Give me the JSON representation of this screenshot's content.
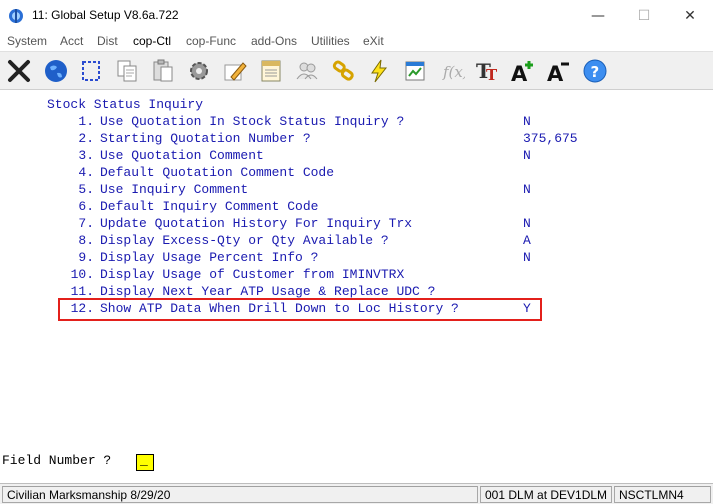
{
  "window": {
    "title": "11: Global Setup V8.6a.722",
    "minimize_glyph": "—",
    "maximize_glyph": "☐",
    "close_glyph": "✕"
  },
  "menu": [
    {
      "label": "System",
      "active": false
    },
    {
      "label": "Acct",
      "active": false
    },
    {
      "label": "Dist",
      "active": false
    },
    {
      "label": "cop-Ctl",
      "active": true
    },
    {
      "label": "cop-Func",
      "active": false
    },
    {
      "label": "add-Ons",
      "active": false
    },
    {
      "label": "Utilities",
      "active": false
    },
    {
      "label": "eXit",
      "active": false
    }
  ],
  "toolbar_icons": [
    "close-icon",
    "globe-icon",
    "select-icon",
    "copy-icon",
    "paste-icon",
    "settings-icon",
    "edit-icon",
    "document-icon",
    "users-icon",
    "link-icon",
    "lightning-icon",
    "chart-icon",
    "function-icon",
    "font-icon",
    "font-increase-icon",
    "font-decrease-icon",
    "help-icon"
  ],
  "screen": {
    "header": "Stock Status Inquiry",
    "options": [
      {
        "num": "1.",
        "label": "Use Quotation In Stock Status Inquiry ?",
        "value": "N"
      },
      {
        "num": "2.",
        "label": "Starting Quotation Number ?",
        "value": "375,675"
      },
      {
        "num": "3.",
        "label": "Use Quotation Comment",
        "value": "N"
      },
      {
        "num": "4.",
        "label": "Default Quotation Comment Code",
        "value": ""
      },
      {
        "num": "5.",
        "label": "Use Inquiry Comment",
        "value": "N"
      },
      {
        "num": "6.",
        "label": "Default Inquiry Comment Code",
        "value": ""
      },
      {
        "num": "7.",
        "label": "Update Quotation History For Inquiry Trx",
        "value": "N"
      },
      {
        "num": "8.",
        "label": "Display Excess-Qty or Qty Available ?",
        "value": "A"
      },
      {
        "num": "9.",
        "label": "Display Usage Percent Info ?",
        "value": "N"
      },
      {
        "num": "10.",
        "label": "Display Usage of Customer from IMINVTRX",
        "value": ""
      },
      {
        "num": "11.",
        "label": "Display Next Year ATP Usage & Replace UDC ?",
        "value": ""
      },
      {
        "num": "12.",
        "label": "Show ATP Data When Drill Down to Loc History ?",
        "value": "Y"
      }
    ],
    "field_prompt": "Field Number ?",
    "field_value": "_"
  },
  "status": {
    "left": "Civilian Marksmanship 8/29/20",
    "middle": "001 DLM at DEV1DLM",
    "right": "NSCTLMN4"
  }
}
